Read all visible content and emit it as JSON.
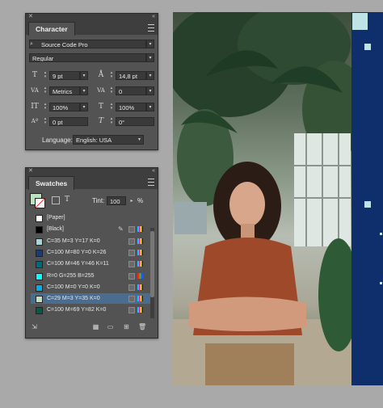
{
  "character": {
    "tab_label": "Character",
    "font_family": "Source Code Pro",
    "font_style": "Regular",
    "font_size": "9 pt",
    "leading": "14,8 pt",
    "kerning": "Metrics",
    "tracking": "0",
    "vertical_scale": "100%",
    "horizontal_scale": "100%",
    "baseline_shift": "0 pt",
    "skew": "0°",
    "language_label": "Language:",
    "language_value": "English: USA"
  },
  "swatches": {
    "tab_label": "Swatches",
    "tint_label": "Tint:",
    "tint_value": "100",
    "percent": "%",
    "items": [
      {
        "name": "[Paper]",
        "color": "#ffffff",
        "type": "none"
      },
      {
        "name": "[Black]",
        "color": "#000000",
        "type": "cmyk-lock"
      },
      {
        "name": "C=35 M=3 Y=17 K=0",
        "color": "#a6d6d6",
        "type": "cmyk"
      },
      {
        "name": "C=100 M=80 Y=0 K=26",
        "color": "#1a3a7a",
        "type": "cmyk"
      },
      {
        "name": "C=100 M=46 Y=46 K=11",
        "color": "#006a78",
        "type": "cmyk"
      },
      {
        "name": "R=0 G=255 B=255",
        "color": "#00ffff",
        "type": "rgb"
      },
      {
        "name": "C=100 M=0 Y=0 K=0",
        "color": "#00aeef",
        "type": "cmyk"
      },
      {
        "name": "C=29 M=3 Y=35 K=0",
        "color": "#bfe0c0",
        "type": "cmyk",
        "selected": true
      },
      {
        "name": "C=100 M=69 Y=82 K=0",
        "color": "#005b4a",
        "type": "cmyk"
      }
    ]
  },
  "colors": {
    "panel_bg": "#535353",
    "selection": "#4a6c8e",
    "blue_panel": "#0f2e6c"
  }
}
